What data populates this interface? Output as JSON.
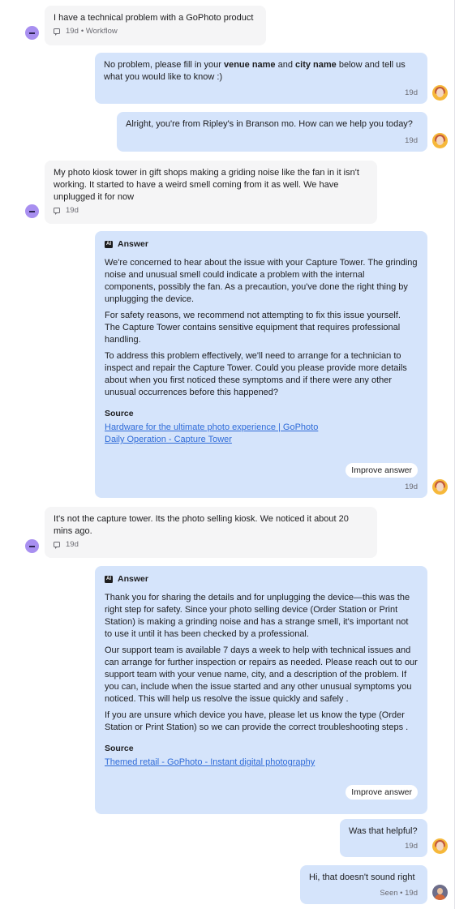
{
  "messages": {
    "m1": {
      "text": "I have a technical problem with a GoPhoto product",
      "meta_time": "19d",
      "meta_source": "• Workflow"
    },
    "m2": {
      "text_a": "No problem, please fill in your ",
      "bold_a": "venue name",
      "text_b": " and ",
      "bold_b": "city name",
      "text_c": " below and tell us what you would like to know :)",
      "time": "19d"
    },
    "m3": {
      "text": "Alright, you're from Ripley's in Branson mo. How can we help you today?",
      "time": "19d"
    },
    "m4": {
      "text": "My photo kiosk tower in gift shops making a griding noise like the fan in it isn't working. It started to have a weird smell coming from it as well. We have unplugged it for now",
      "meta_time": "19d"
    },
    "m5": {
      "header": "Answer",
      "ai_badge": "AI",
      "paragraphs": [
        "We're concerned to hear about the issue with your Capture Tower. The grinding noise and unusual smell could indicate a problem with the internal components, possibly the fan. As a precaution, you've done the right thing by unplugging the device.",
        "For safety reasons, we recommend not attempting to fix this issue yourself. The Capture Tower contains sensitive equipment that requires professional handling.",
        "To address this problem effectively, we'll need to arrange for a technician to inspect and repair the Capture Tower. Could you please provide more details about when you first noticed these symptoms and if there were any other unusual occurrences before this happened?"
      ],
      "source_title": "Source",
      "links": [
        "Hardware for the ultimate photo experience | GoPhoto",
        "Daily Operation - Capture Tower"
      ],
      "improve_label": "Improve answer",
      "time": "19d"
    },
    "m6": {
      "text": "It's not the capture tower. Its the photo selling kiosk. We noticed it about 20 mins ago.",
      "meta_time": "19d"
    },
    "m7": {
      "header": "Answer",
      "ai_badge": "AI",
      "paragraphs": [
        "Thank you for sharing the details and for unplugging the device—this was the right step for safety. Since your photo selling device (Order Station or Print Station) is making a grinding noise and has a strange smell, it's important not to use it until it has been checked by a professional.",
        "Our support team is available 7 days a week to help with technical issues and can arrange for further inspection or repairs as needed. Please reach out to our support team with your venue name, city, and a description of the problem. If you can, include when the issue started and any other unusual symptoms you noticed. This will help us resolve the issue quickly and safely .",
        "If you are unsure which device you have, please let us know the type (Order Station or Print Station) so we can provide the correct troubleshooting steps ."
      ],
      "source_title": "Source",
      "links": [
        "Themed retail - GoPhoto - Instant digital photography"
      ],
      "improve_label": "Improve answer"
    },
    "m8": {
      "text": "Was that helpful?",
      "time": "19d"
    },
    "m9": {
      "text": "Hi, that doesn't sound right",
      "time": "Seen • 19d"
    }
  },
  "icons": {
    "customer_avatar": "minus-circle-avatar",
    "bot_avatar": "bot-avatar",
    "agent_avatar": "agent-avatar",
    "meta": "chat-bubble-icon",
    "ai": "ai-badge-icon"
  },
  "colors": {
    "incoming_bubble": "#f5f5f6",
    "outgoing_bubble": "#d5e4fb",
    "link": "#2f6bd8",
    "customer_avatar": "#a88ff0"
  }
}
